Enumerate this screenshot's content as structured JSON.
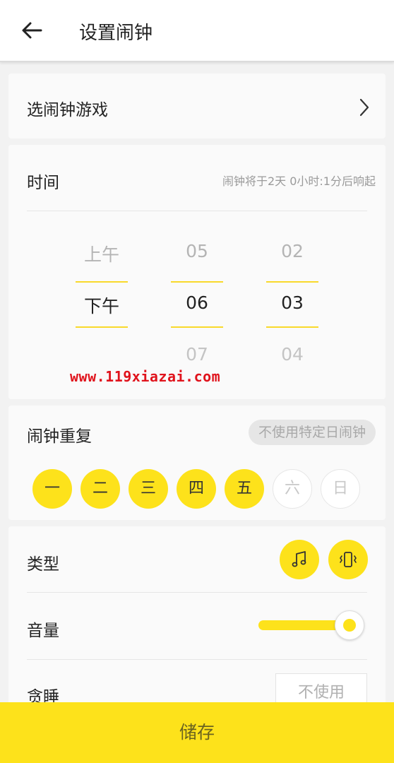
{
  "header": {
    "title": "设置闹钟",
    "back_icon": "arrow-left-icon"
  },
  "game": {
    "label": "选闹钟游戏",
    "chevron_icon": "chevron-right-icon"
  },
  "time": {
    "label": "时间",
    "hint": "闹钟将于2天 0小时:1分后响起",
    "ampm": {
      "prev": "上午",
      "selected": "下午",
      "next": ""
    },
    "hour": {
      "prev": "05",
      "selected": "06",
      "next": "07"
    },
    "minute": {
      "prev": "02",
      "selected": "03",
      "next": "04"
    }
  },
  "watermark": "www.119xiazai.com",
  "repeat": {
    "label": "闹钟重复",
    "specific_button": "不使用特定日闹钟",
    "days": [
      {
        "label": "一",
        "selected": true
      },
      {
        "label": "二",
        "selected": true
      },
      {
        "label": "三",
        "selected": true
      },
      {
        "label": "四",
        "selected": true
      },
      {
        "label": "五",
        "selected": true
      },
      {
        "label": "六",
        "selected": false
      },
      {
        "label": "日",
        "selected": false
      }
    ]
  },
  "settings": {
    "type_label": "类型",
    "type_icons": [
      "music-note-icon",
      "vibrate-phone-icon"
    ],
    "volume_label": "音量",
    "volume_level": 1.0,
    "snooze_label": "贪睡",
    "snooze_value": "不使用"
  },
  "save_button": "储存",
  "colors": {
    "accent": "#fde21b",
    "background": "#f2f2f2",
    "card": "#fafafa"
  }
}
